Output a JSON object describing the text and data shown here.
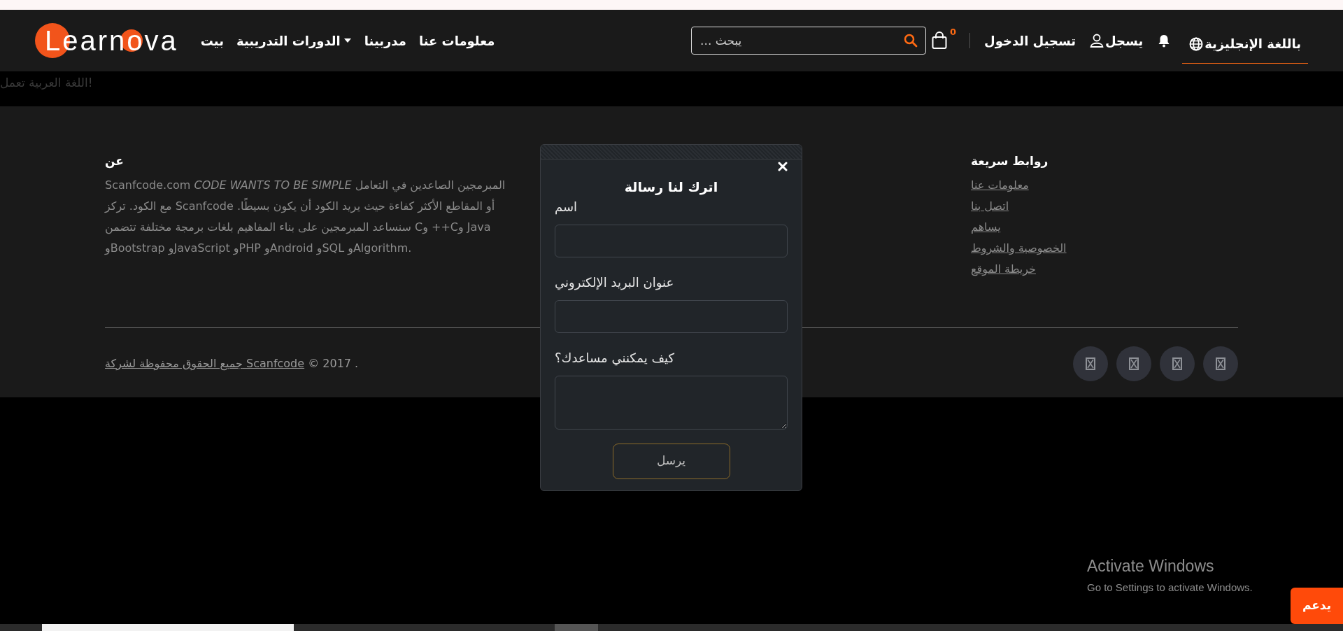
{
  "logo": "Learnova",
  "nav": [
    {
      "label": "معلومات عنا",
      "dropdown": false
    },
    {
      "label": "مدربينا",
      "dropdown": false
    },
    {
      "label": "الدورات التدريبية",
      "dropdown": true
    },
    {
      "label": "بيت",
      "dropdown": false
    }
  ],
  "search": {
    "placeholder": "... يبحث"
  },
  "cart": {
    "count": "0"
  },
  "login": "تسجيل الدخول",
  "register": "يسجل",
  "language": "باللغة الإنجليزية",
  "notice": "اللغة العربية تعمل!",
  "footer": {
    "about": {
      "heading": "عن",
      "lines": [
        {
          "text": "Scanfcode.com *CODE WANTS TO BE SIMPLE* المبرمجين الصاعدين في التعامل",
          "kind": "latin"
        },
        {
          "text": "أو المقاطع الأكثر كفاءة حيث يريد الكود أن يكون بسيطًا. Scanfcode مع الكود. تركز",
          "kind": "arabic"
        },
        {
          "text": "Java وC++ وC سنساعد المبرمجين على بناء المفاهيم بلغات برمجة مختلفة تتضمن",
          "kind": "arabic"
        },
        {
          "text": "وBootstrap وJavaScript وPHP وAndroid وSQL وAlgorithm.",
          "kind": "latin"
        }
      ]
    },
    "quick_links": {
      "heading": "روابط سريعة",
      "links": [
        "معلومات عنا",
        "اتصل بنا",
        "يساهم",
        "الخصوصية والشروط",
        "خريطة الموقع"
      ]
    },
    "copyright": {
      "link": "جميع الحقوق محفوظة لشركة Scanfcode",
      "text": " © 2017 ."
    }
  },
  "modal": {
    "title": "اترك لنا رسالة",
    "fields": [
      {
        "label": "اسم",
        "kind": "input"
      },
      {
        "label": "عنوان البريد الإلكتروني",
        "kind": "input"
      },
      {
        "label": "كيف يمكنني مساعدك؟",
        "kind": "textarea"
      }
    ],
    "submit": "يرسل"
  },
  "windows_notice": {
    "title": "Activate Windows",
    "subtitle": "Go to Settings to activate Windows."
  },
  "support_button": "يدعم"
}
